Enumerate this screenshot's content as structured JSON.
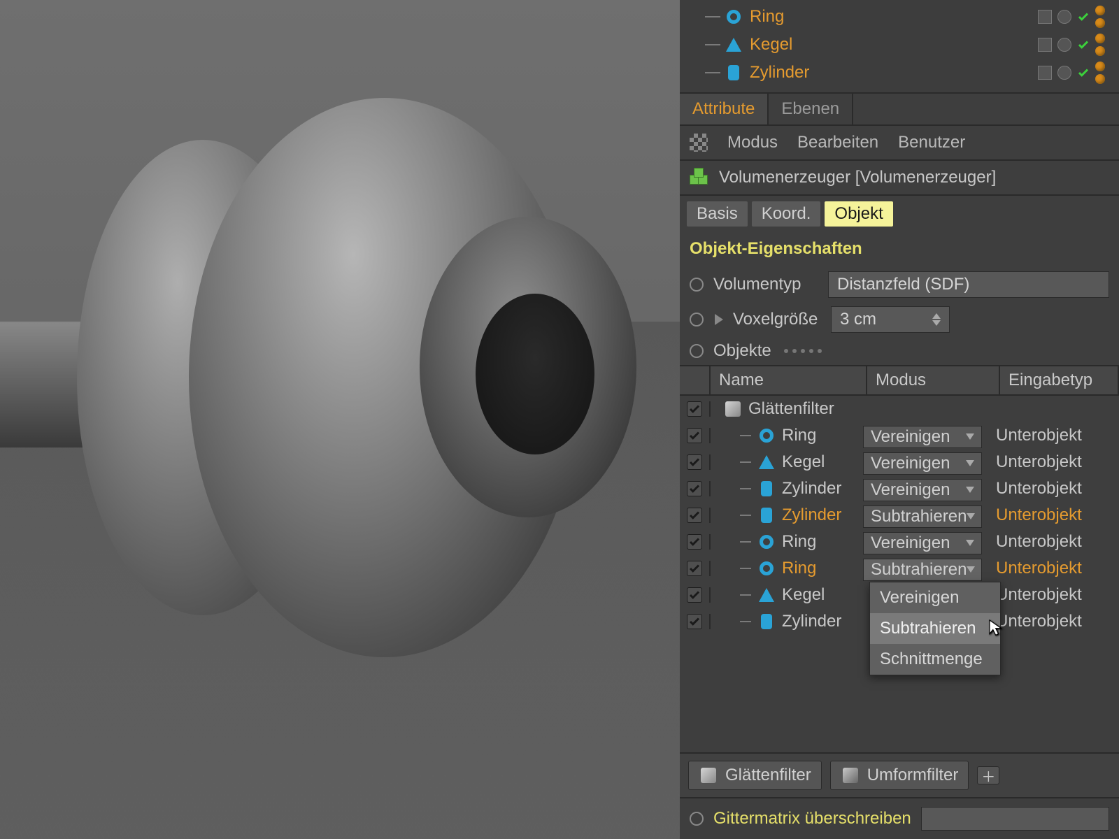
{
  "object_manager": {
    "rows": [
      {
        "icon": "ring",
        "name": "Ring"
      },
      {
        "icon": "cone",
        "name": "Kegel"
      },
      {
        "icon": "cyl",
        "name": "Zylinder"
      }
    ]
  },
  "tabs": {
    "attribute": "Attribute",
    "ebenen": "Ebenen"
  },
  "menu": {
    "modus": "Modus",
    "bearbeiten": "Bearbeiten",
    "benutzer": "Benutzer"
  },
  "title": "Volumenerzeuger [Volumenerzeuger]",
  "subtabs": {
    "basis": "Basis",
    "koord": "Koord.",
    "objekt": "Objekt"
  },
  "section_heading": "Objekt-Eigenschaften",
  "props": {
    "volumentyp_label": "Volumentyp",
    "volumentyp_value": "Distanzfeld (SDF)",
    "voxel_label": "Voxelgröße",
    "voxel_value": "3 cm",
    "objekte_label": "Objekte"
  },
  "list_head": {
    "name": "Name",
    "modus": "Modus",
    "eingabetyp": "Eingabetyp"
  },
  "list": [
    {
      "icon": "smooth",
      "name": "Glättenfilter",
      "mode": null,
      "inp": null,
      "hl": false,
      "indent": 0
    },
    {
      "icon": "ring",
      "name": "Ring",
      "mode": "Vereinigen",
      "inp": "Unterobjekt",
      "hl": false,
      "indent": 1
    },
    {
      "icon": "cone",
      "name": "Kegel",
      "mode": "Vereinigen",
      "inp": "Unterobjekt",
      "hl": false,
      "indent": 1
    },
    {
      "icon": "cyl",
      "name": "Zylinder",
      "mode": "Vereinigen",
      "inp": "Unterobjekt",
      "hl": false,
      "indent": 1
    },
    {
      "icon": "cyl",
      "name": "Zylinder",
      "mode": "Subtrahieren",
      "inp": "Unterobjekt",
      "hl": true,
      "indent": 1
    },
    {
      "icon": "ring",
      "name": "Ring",
      "mode": "Vereinigen",
      "inp": "Unterobjekt",
      "hl": false,
      "indent": 1
    },
    {
      "icon": "ring",
      "name": "Ring",
      "mode": "Subtrahieren",
      "inp": "Unterobjekt",
      "hl": true,
      "indent": 1,
      "open": true
    },
    {
      "icon": "cone",
      "name": "Kegel",
      "mode": null,
      "inp": "Unterobjekt",
      "hl": false,
      "indent": 1
    },
    {
      "icon": "cyl",
      "name": "Zylinder",
      "mode": null,
      "inp": "Unterobjekt",
      "hl": false,
      "indent": 1
    }
  ],
  "dropdown": {
    "vereinigen": "Vereinigen",
    "subtrahieren": "Subtrahieren",
    "schnittmenge": "Schnittmenge"
  },
  "buttons": {
    "glatten": "Glättenfilter",
    "umform": "Umformfilter"
  },
  "footer": {
    "label": "Gittermatrix überschreiben"
  }
}
